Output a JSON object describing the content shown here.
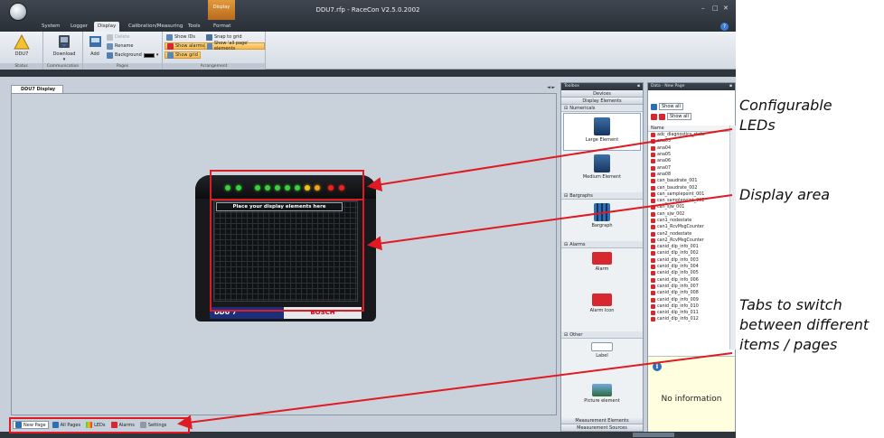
{
  "window": {
    "title": "DDU7.rfp - RaceCon V2.5.0.2002",
    "context_tab": "Display",
    "controls": [
      "–",
      "□",
      "✕"
    ],
    "help": "?"
  },
  "menu": {
    "tabs": [
      "System",
      "Logger",
      "Display",
      "Calibration/Measuring",
      "Tools",
      "Format"
    ],
    "active": "Display"
  },
  "ribbon": {
    "status_group": "Status",
    "device_label": "DDU7",
    "communication_group": "Communication",
    "download_label": "Download",
    "pages_group": "Pages",
    "add_label": "Add",
    "delete_label": "Delete",
    "rename_label": "Rename",
    "background_label": "Background",
    "arrangement_group": "Arrangement",
    "show_ids": "Show IDs",
    "snap_to_grid": "Snap to grid",
    "show_alarms": "Show alarms",
    "show_all_page_elements": "Show 'all page' elements",
    "show_grid": "Show grid"
  },
  "document": {
    "tab_label": "DDU7 Display",
    "tab_arrows": "◄ ►",
    "screen_label": "Place your display elements here",
    "ddu_label": "DDU 7",
    "bosch_label": "BOSCH",
    "leds": [
      "#39d13c",
      "#39d13c",
      "#39d13c",
      "#39d13c",
      "#39d13c",
      "#39d13c",
      "#39d13c",
      "#f0c21a",
      "#f0a21a",
      "#e8241c",
      "#e8241c"
    ]
  },
  "page_tabs": [
    {
      "label": "New Page",
      "active": true
    },
    {
      "label": "All Pages",
      "active": false
    },
    {
      "label": "LEDs",
      "active": false
    },
    {
      "label": "Alarms",
      "active": false
    },
    {
      "label": "Settings",
      "active": false
    }
  ],
  "toolbox": {
    "title": "Toolbox",
    "devices": "Devices",
    "display_elements": "Display Elements",
    "numericals": "Numericals",
    "large_element": "Large Element",
    "medium_element": "Medium Element",
    "bargraphs": "Bargraphs",
    "bargraph": "Bargraph",
    "alarms": "Alarms",
    "alarm": "Alarm",
    "alarm_icon": "Alarm Icon",
    "other": "Other",
    "label": "Label",
    "picture_element": "Picture element",
    "measurement_elements": "Measurement Elements",
    "measurement_sources": "Measurement Sources"
  },
  "data_panel": {
    "title": "Data - New Page",
    "show_all": "Show all",
    "show_all_2": "Show all",
    "name_header": "Name",
    "variables": [
      "adc_diagnostics_state",
      "ana03",
      "ana04",
      "ana05",
      "ana06",
      "ana07",
      "ana08",
      "can_baudrate_001",
      "can_baudrate_002",
      "can_samplepoint_001",
      "can_samplepoint_002",
      "can_sjw_001",
      "can_sjw_002",
      "can1_nodestate",
      "can1_RcvMsgCounter",
      "can2_nodestate",
      "can2_RcvMsgCounter",
      "canid_dlp_info_001",
      "canid_dlp_info_002",
      "canid_dlp_info_003",
      "canid_dlp_info_004",
      "canid_dlp_info_005",
      "canid_dlp_info_006",
      "canid_dlp_info_007",
      "canid_dlp_info_008",
      "canid_dlp_info_009",
      "canid_dlp_info_010",
      "canid_dlp_info_011",
      "canid_dlp_info_012"
    ],
    "info_text": "No information"
  },
  "annotations": {
    "configurable_leds": [
      "Configurable",
      "LEDs"
    ],
    "display_area": [
      "Display area"
    ],
    "tabs_to_switch": [
      "Tabs to switch",
      "between different",
      "items / pages"
    ]
  },
  "colors": {
    "annotation_arrow": "#e01a22",
    "highlight_box": "#e01a22",
    "ribbon_highlight": "#f6b64b",
    "title_bar": "#2a3037"
  }
}
